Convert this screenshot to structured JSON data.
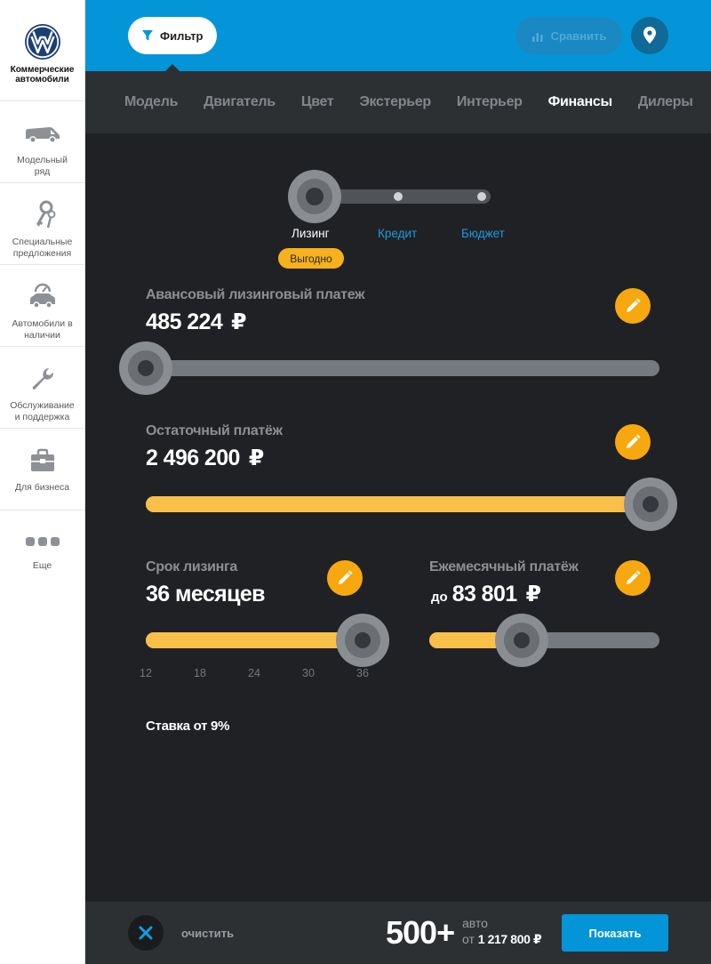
{
  "brand": {
    "title": "Коммерческие автомобили"
  },
  "sidebar": {
    "items": [
      {
        "label": "Модельный\nряд",
        "icon": "van-icon"
      },
      {
        "label": "Специальные\nпредложения",
        "icon": "keys-icon"
      },
      {
        "label": "Автомобили в\nналичии",
        "icon": "car-speedometer-icon"
      },
      {
        "label": "Обслуживание\nи поддержка",
        "icon": "wrench-icon"
      },
      {
        "label": "Для бизнеса",
        "icon": "briefcase-icon"
      },
      {
        "label": "Еще",
        "icon": "more-dots-icon"
      }
    ]
  },
  "header": {
    "filter_label": "Фильтр",
    "compare_label": "Сравнить"
  },
  "tabs": [
    {
      "label": "Модель"
    },
    {
      "label": "Двигатель"
    },
    {
      "label": "Цвет"
    },
    {
      "label": "Экстерьер"
    },
    {
      "label": "Интерьер"
    },
    {
      "label": "Финансы",
      "active": true
    },
    {
      "label": "Дилеры"
    }
  ],
  "finance": {
    "modes": [
      "Лизинг",
      "Кредит",
      "Бюджет"
    ],
    "selected_mode": "Лизинг",
    "badge": "Выгодно",
    "advance": {
      "label": "Авансовый лизинговый платеж",
      "value": "485 224",
      "currency": "₽",
      "slider_level": 0.0
    },
    "residual": {
      "label": "Остаточный платёж",
      "value": "2 496 200",
      "currency": "₽",
      "slider_level": 1.0
    },
    "term": {
      "label": "Срок лизинга",
      "value": "36 месяцев",
      "slider_level": 1.0,
      "ticks": [
        "12",
        "18",
        "24",
        "30",
        "36"
      ]
    },
    "monthly": {
      "label": "Ежемесячный платёж",
      "prefix": "до",
      "value": "83 801",
      "currency": "₽",
      "slider_level": 0.4
    },
    "rate": "Ставка от 9%"
  },
  "footer": {
    "clear_label": "очистить",
    "count": "500+",
    "count_unit": "авто",
    "from_prefix": "от",
    "from_price": "1 217 800 ₽",
    "show_label": "Показать"
  },
  "colors": {
    "accent_blue": "#0495d8",
    "accent_orange": "#f8a80f",
    "slider_fill": "#f8c048",
    "dark_bg": "#202124"
  }
}
